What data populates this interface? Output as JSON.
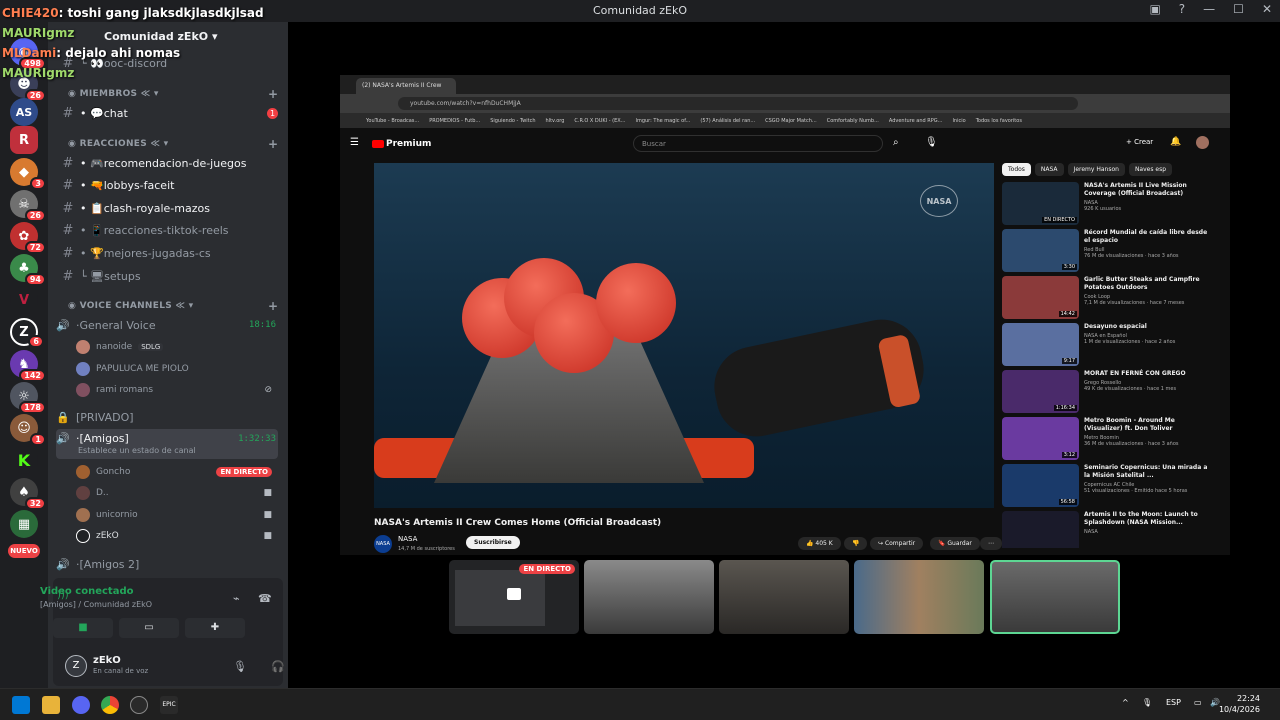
{
  "window": {
    "title": "Comunidad zEkO"
  },
  "chat_overlay": [
    {
      "user": "CHIE420",
      "text": "toshi gang jlaksdkjlasdkjlsad"
    },
    {
      "user": "MAURIgmz",
      "text": ""
    },
    {
      "user": "MLDami",
      "text": "dejalo ahi nomas"
    },
    {
      "user": "MAURIgmz",
      "text": ""
    }
  ],
  "servers": {
    "badges": [
      "498",
      "26",
      "3",
      "26",
      "72",
      "94",
      "6",
      "142",
      "178",
      "1",
      "32"
    ],
    "new_label": "NUEVO"
  },
  "guild": {
    "name": "Comunidad zEkO"
  },
  "channels": {
    "top": {
      "name": "ooc-discord"
    },
    "categories": {
      "miembros": "MIEMBROS",
      "reacciones": "REACCIONES",
      "voice": "VOICE CHANNELS"
    },
    "chat": {
      "name": "chat",
      "unread": "1"
    },
    "text": [
      {
        "name": "recomendacion-de-juegos"
      },
      {
        "name": "lobbys-faceit"
      },
      {
        "name": "clash-royale-mazos"
      },
      {
        "name": "reacciones-tiktok-reels"
      },
      {
        "name": "mejores-jugadas-cs"
      },
      {
        "name": "setups"
      }
    ],
    "voice": {
      "general": {
        "name": "General Voice",
        "time": "18:16"
      },
      "general_users": [
        {
          "name": "nanoide",
          "tag": "SDLG"
        },
        {
          "name": "PAPULUCA ME PIOLO",
          "tag": ""
        },
        {
          "name": "rami romans",
          "tag": ""
        }
      ],
      "privado": {
        "name": "[PRIVADO]"
      },
      "amigos": {
        "name": "[Amigos]",
        "time": "1:32:33",
        "status": "Establece un estado de canal"
      },
      "amigos_users": [
        {
          "name": "Goncho",
          "live": "EN DIRECTO"
        },
        {
          "name": "D.."
        },
        {
          "name": "unicornio"
        },
        {
          "name": "zEkO"
        }
      ],
      "amigos2": {
        "name": "[Amigos 2]"
      }
    }
  },
  "voice_panel": {
    "status": "Video conectado",
    "location": "[Amigos] / Comunidad zEkO",
    "user": {
      "name": "zEkO",
      "status": "En canal de voz"
    }
  },
  "browser": {
    "tab_title": "(2) NASA's Artemis II Crew",
    "url": "youtube.com/watch?v=nfhDuCHMjJA",
    "bookmarks": [
      "YouTube - Broadcas...",
      "PROMEDIOS - Futb...",
      "Siguiendo - Twitch",
      "hltv.org",
      "C.R.O X DUKI - (EX...",
      "Imgur: The magic of...",
      "(57) Análisis del ran...",
      "CSGO Major Match...",
      "Comfortably Numb...",
      "Adventure and RPG...",
      "Inicio",
      "Todos los favoritos"
    ]
  },
  "youtube": {
    "brand": "Premium",
    "search_placeholder": "Buscar",
    "create": "Crear",
    "video_title": "NASA's Artemis II Crew Comes Home (Official Broadcast)",
    "channel": "NASA",
    "subscribers": "14,7 M de suscriptores",
    "subscribe": "Suscribirse",
    "likes": "405 K",
    "share": "Compartir",
    "save": "Guardar",
    "watermark": "NASA",
    "chips": [
      "Todos",
      "NASA",
      "Jeremy Hanson",
      "Naves esp"
    ],
    "recommendations": [
      {
        "title": "NASA's Artemis II Live Mission Coverage (Official Broadcast)",
        "channel": "NASA",
        "meta": "926 K usuarios",
        "badge": "EN DIRECTO",
        "color": "#1a2a3a"
      },
      {
        "title": "Récord Mundial de caída libre desde el espacio",
        "channel": "Red Bull",
        "meta": "76 M de visualizaciones · hace 3 años",
        "badge": "3:30",
        "color": "#2c4a6e"
      },
      {
        "title": "Garlic Butter Steaks and Campfire Potatoes Outdoors",
        "channel": "Cook Loop",
        "meta": "7,1 M de visualizaciones · hace 7 meses",
        "badge": "14:42",
        "color": "#8b3a3a"
      },
      {
        "title": "Desayuno espacial",
        "channel": "NASA en Español",
        "meta": "1 M de visualizaciones · hace 2 años",
        "badge": "9:17",
        "color": "#5a6fa0"
      },
      {
        "title": "MORAT EN FERNÉ CON GREGO",
        "channel": "Grego Rossello",
        "meta": "49 K de visualizaciones · hace 1 mes",
        "badge": "1:16:34",
        "color": "#4a2a6a"
      },
      {
        "title": "Metro Boomin - Around Me (Visualizer) ft. Don Toliver",
        "channel": "Metro Boomin",
        "meta": "36 M de visualizaciones · hace 3 años",
        "badge": "3:12",
        "color": "#6a3aa0"
      },
      {
        "title": "Seminario Copernicus: Una mirada a la Misión Satelital ...",
        "channel": "Copernicus AC Chile",
        "meta": "51 visualizaciones · Emitido hace 5 horas",
        "badge": "56:58",
        "color": "#1a3a6a"
      },
      {
        "title": "Artemis II to the Moon: Launch to Splashdown (NASA Mission...",
        "channel": "NASA",
        "meta": "",
        "badge": "",
        "color": "#1a1a2a"
      }
    ]
  },
  "stream_tiles": {
    "live_label": "EN DIRECTO"
  },
  "taskbar": {
    "lang": "ESP",
    "time": "22:24",
    "date": "10/4/2026"
  }
}
